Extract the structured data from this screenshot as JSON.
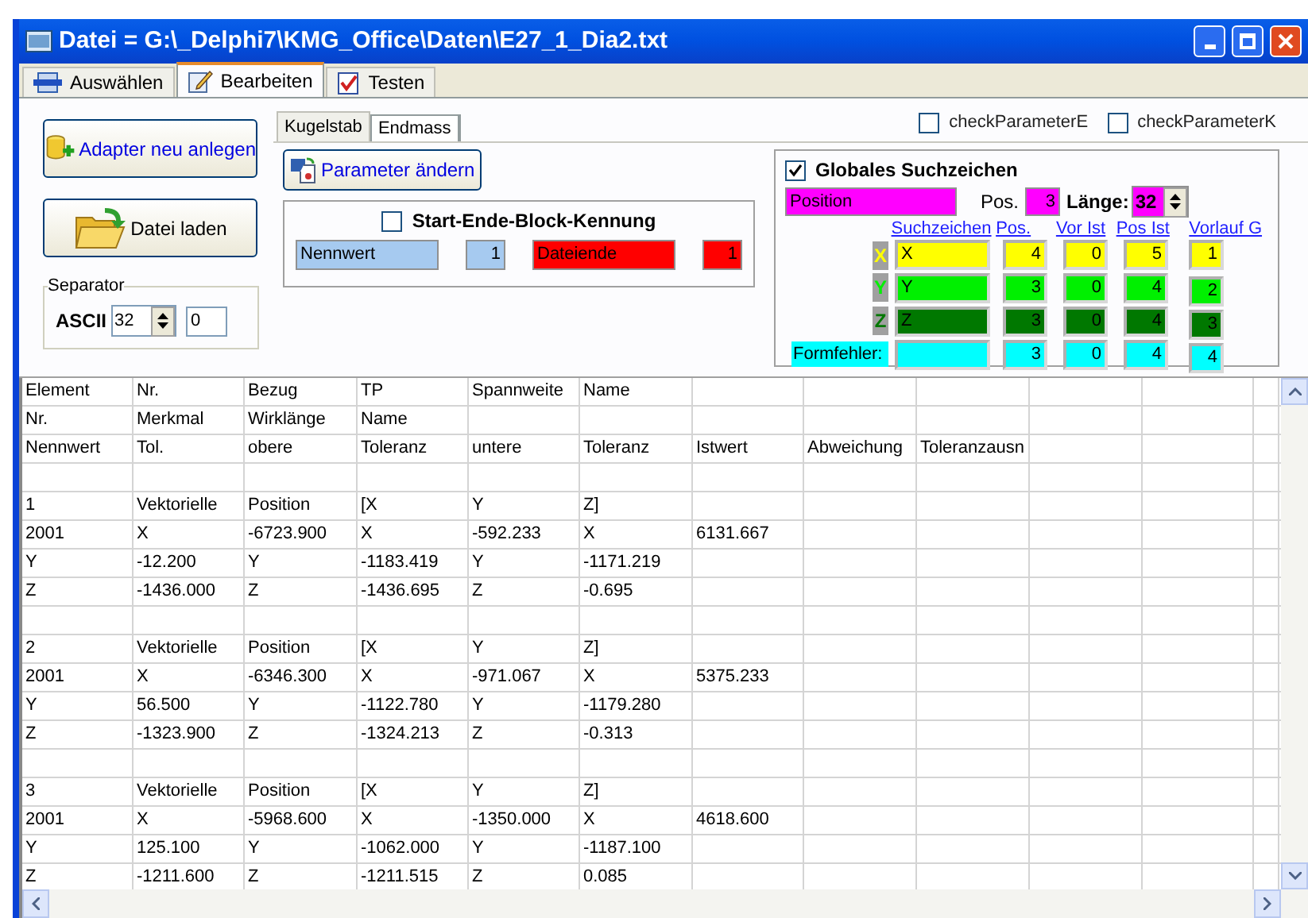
{
  "window": {
    "title": "Datei = G:\\_Delphi7\\KMG_Office\\Daten\\E27_1_Dia2.txt"
  },
  "tabs": [
    {
      "label": "Auswählen",
      "selected": false
    },
    {
      "label": "Bearbeiten",
      "selected": true
    },
    {
      "label": "Testen",
      "selected": false
    }
  ],
  "left_panel": {
    "buttons": [
      {
        "label": "Adapter neu anlegen"
      },
      {
        "label": "Datei laden"
      }
    ],
    "separator": {
      "title": "Separator",
      "label": "ASCII",
      "value": "32",
      "code": "0"
    }
  },
  "inner_tabs": [
    {
      "label": "Kugelstab",
      "selected": true
    },
    {
      "label": "Endmass",
      "selected": false
    }
  ],
  "checks": [
    {
      "label": "checkParameterE",
      "checked": false
    },
    {
      "label": "checkParameterK",
      "checked": false
    }
  ],
  "parameter_button": {
    "label": "Parameter ändern"
  },
  "block": {
    "label": "Start-Ende-Block-Kennung",
    "checked": false,
    "fields": [
      {
        "value": "Nennwert",
        "color": "#a6caf0",
        "kind": "text"
      },
      {
        "value": "1",
        "color": "#a6caf0",
        "kind": "number"
      },
      {
        "value": "Dateiende",
        "color": "#ff0000",
        "kind": "text"
      },
      {
        "value": "1",
        "color": "#ff0000",
        "kind": "number"
      }
    ]
  },
  "global": {
    "label": "Globales Suchzeichen",
    "checked": true,
    "search_value": "Position",
    "pos_label": "Pos.",
    "pos_value": "3",
    "length_label": "Länge:",
    "length_value": "32",
    "columns": [
      "Suchzeichen",
      "Pos.",
      "Vor Ist",
      "Pos Ist",
      "Vorlauf G"
    ],
    "rows": [
      {
        "kind": "axis",
        "label": "X",
        "color": "#ffff00",
        "values": [
          "X",
          "4",
          "0",
          "5",
          "1"
        ]
      },
      {
        "kind": "axis",
        "label": "Y",
        "color": "#00f000",
        "values": [
          "Y",
          "3",
          "0",
          "4",
          "2"
        ]
      },
      {
        "kind": "axis",
        "label": "Z",
        "color": "#007800",
        "values": [
          "Z",
          "3",
          "0",
          "4",
          "3"
        ]
      },
      {
        "kind": "error",
        "label": "Formfehler:",
        "color": "#00ffff",
        "values": [
          "3",
          "0",
          "4",
          "4"
        ]
      }
    ]
  },
  "grid": {
    "rows": [
      {
        "kind": "data",
        "cells": [
          "Element",
          "Nr.",
          "Bezug",
          "TP",
          "Spannweite",
          "Name"
        ]
      },
      {
        "kind": "data",
        "cells": [
          "Nr.",
          "Merkmal",
          "Wirklänge",
          "Name"
        ]
      },
      {
        "kind": "data",
        "cells": [
          "Nennwert",
          "Tol.",
          "obere",
          "Toleranz",
          "untere",
          "Toleranz",
          "Istwert",
          "Abweichung",
          "Toleranzausn"
        ]
      },
      {
        "kind": "blank"
      },
      {
        "kind": "data",
        "cells": [
          "1",
          "Vektorielle",
          "Position",
          "[X",
          "Y",
          "Z]"
        ]
      },
      {
        "kind": "data",
        "cells": [
          "2001",
          "X",
          "-6723.900",
          "X",
          "-592.233",
          "X",
          "6131.667"
        ]
      },
      {
        "kind": "data",
        "cells": [
          "Y",
          "-12.200",
          "Y",
          "-1183.419",
          "Y",
          "-1171.219"
        ]
      },
      {
        "kind": "data",
        "cells": [
          "Z",
          "-1436.000",
          "Z",
          "-1436.695",
          "Z",
          "-0.695"
        ]
      },
      {
        "kind": "blank"
      },
      {
        "kind": "data",
        "cells": [
          "2",
          "Vektorielle",
          "Position",
          "[X",
          "Y",
          "Z]"
        ]
      },
      {
        "kind": "data",
        "cells": [
          "2001",
          "X",
          "-6346.300",
          "X",
          "-971.067",
          "X",
          "5375.233"
        ]
      },
      {
        "kind": "data",
        "cells": [
          "Y",
          "56.500",
          "Y",
          "-1122.780",
          "Y",
          "-1179.280"
        ]
      },
      {
        "kind": "data",
        "cells": [
          "Z",
          "-1323.900",
          "Z",
          "-1324.213",
          "Z",
          "-0.313"
        ]
      },
      {
        "kind": "blank"
      },
      {
        "kind": "data",
        "cells": [
          "3",
          "Vektorielle",
          "Position",
          "[X",
          "Y",
          "Z]"
        ]
      },
      {
        "kind": "data",
        "cells": [
          "2001",
          "X",
          "-5968.600",
          "X",
          "-1350.000",
          "X",
          "4618.600"
        ]
      },
      {
        "kind": "data",
        "cells": [
          "Y",
          "125.100",
          "Y",
          "-1062.000",
          "Y",
          "-1187.100"
        ]
      },
      {
        "kind": "data",
        "cells": [
          "Z",
          "-1211.600",
          "Z",
          "-1211.515",
          "Z",
          "0.085"
        ]
      }
    ]
  }
}
